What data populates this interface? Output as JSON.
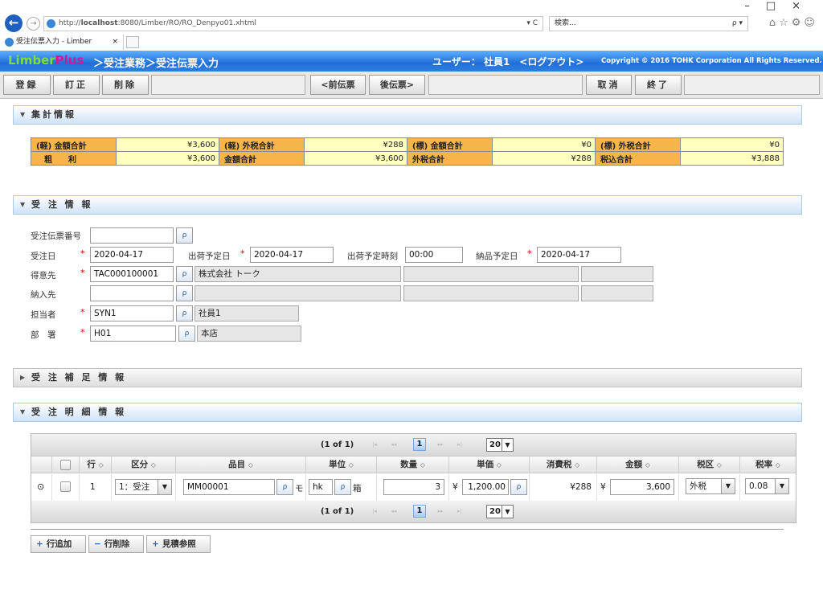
{
  "browser": {
    "url_prefix": "http://",
    "url_host": "localhost",
    "url_rest": ":8080/Limber/RO/RO_Denpyo01.xhtml",
    "url_tools": "▾ C",
    "search_placeholder": "検索...",
    "search_tools": "ρ ▾",
    "tab_title": "受注伝票入力 - Limber",
    "tab_close": "×",
    "win_controls": "–□×",
    "toolbar_icons": "⌂☆⚙☺"
  },
  "header": {
    "logo_a": "Li",
    "logo_b": "mber",
    "logo_c": "Plus",
    "breadcrumb": "＞受注業務＞受注伝票入力",
    "user": "ユーザー： 社員1　<ログアウト>",
    "copyright": "Copyright © 2016 TOHK Corporation All Rights Reserved."
  },
  "toolbar": {
    "register": "登録",
    "correct": "訂正",
    "delete": "削除",
    "prev": "<前伝票",
    "next": "後伝票>",
    "cancel": "取消",
    "end": "終了"
  },
  "sections": {
    "summary": "集計情報",
    "order": "受 注 情 報",
    "supplement": "受 注 補 足 情 報",
    "detail": "受 注 明 細 情 報",
    "expanded_arrow": "▼",
    "collapsed_arrow": "▶"
  },
  "summary": {
    "rows": [
      [
        {
          "label": "(軽) 金額合計",
          "value": "¥3,600"
        },
        {
          "label": "(軽) 外税合計",
          "value": "¥288"
        },
        {
          "label": "(標) 金額合計",
          "value": "¥0"
        },
        {
          "label": "(標) 外税合計",
          "value": "¥0"
        }
      ],
      [
        {
          "label": "　粗　　利",
          "value": "¥3,600"
        },
        {
          "label": "金額合計",
          "value": "¥3,600"
        },
        {
          "label": "外税合計",
          "value": "¥288"
        },
        {
          "label": "税込合計",
          "value": "¥3,888"
        }
      ]
    ]
  },
  "order": {
    "slip_no_label": "受注伝票番号",
    "slip_no": "",
    "order_date_label": "受注日",
    "order_date": "2020-04-17",
    "ship_date_label": "出荷予定日",
    "ship_date": "2020-04-17",
    "ship_time_label": "出荷予定時刻",
    "ship_time": "00:00",
    "delivery_date_label": "納品予定日",
    "delivery_date": "2020-04-17",
    "customer_label": "得意先",
    "customer_code": "TAC000100001",
    "customer_name": "株式会社 トーク",
    "delivery_to_label": "納入先",
    "delivery_to_code": "",
    "staff_label": "担当者",
    "staff_code": "SYN1",
    "staff_name": "社員1",
    "dept_label": "部　署",
    "dept_code": "H01",
    "dept_name": "本店",
    "required_mark": "*",
    "lookup_icon": "ρ"
  },
  "grid": {
    "page_info": "(1 of 1)",
    "current_page": "1",
    "page_size": "20",
    "nav_first": "|◂",
    "nav_prev": "◂◂",
    "nav_next": "▸▸",
    "nav_last": "▸|",
    "dd_icon": "▼",
    "sort_icon": "◇",
    "columns": [
      "行",
      "区分",
      "品目",
      "単位",
      "数量",
      "単価",
      "消費税",
      "金額",
      "税区",
      "税率"
    ],
    "row": {
      "expander": "⊙",
      "line": "1",
      "kubun": "1：受注",
      "item_code": "MM00001",
      "item_name_trunc": "モ",
      "unit_code": "hk",
      "unit_name": "箱",
      "qty": "3",
      "yen": "¥",
      "price": "1,200.00",
      "tax": "¥288",
      "amount": "3,600",
      "tax_type": "外税",
      "tax_rate": "0.08"
    }
  },
  "actions": {
    "add_row": "行追加",
    "delete_row": "行削除",
    "estimate": "見積参照",
    "plus_icon": "+",
    "minus_icon": "−"
  }
}
